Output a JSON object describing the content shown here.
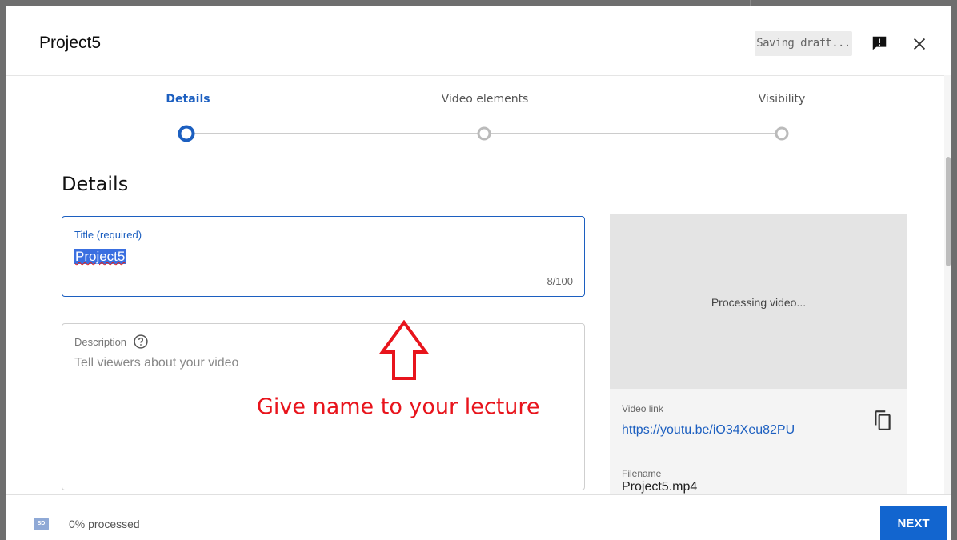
{
  "header": {
    "title": "Project5",
    "saving_status": "Saving draft..."
  },
  "stepper": {
    "steps": [
      {
        "label": "Details",
        "active": true
      },
      {
        "label": "Video elements",
        "active": false
      },
      {
        "label": "Visibility",
        "active": false
      }
    ]
  },
  "details": {
    "section_title": "Details",
    "title_field": {
      "label": "Title (required)",
      "value": "Project5",
      "char_count": "8/100"
    },
    "description_field": {
      "label": "Description",
      "placeholder": "Tell viewers about your video"
    }
  },
  "annotation": {
    "text": "Give name to your lecture",
    "color": "#e8141c"
  },
  "preview": {
    "status": "Processing video...",
    "video_link_label": "Video link",
    "video_link": "https://youtu.be/iO34Xeu82PU",
    "filename_label": "Filename",
    "filename": "Project5.mp4"
  },
  "footer": {
    "quality_badge": "SD",
    "processed_text": "0% processed",
    "next_label": "NEXT"
  },
  "colors": {
    "accent": "#1c5fc0",
    "next_button": "#1265cf",
    "annotation": "#e8141c"
  },
  "icons": [
    "feedback-icon",
    "close-icon",
    "help-icon",
    "copy-icon",
    "arrow-up-icon"
  ]
}
